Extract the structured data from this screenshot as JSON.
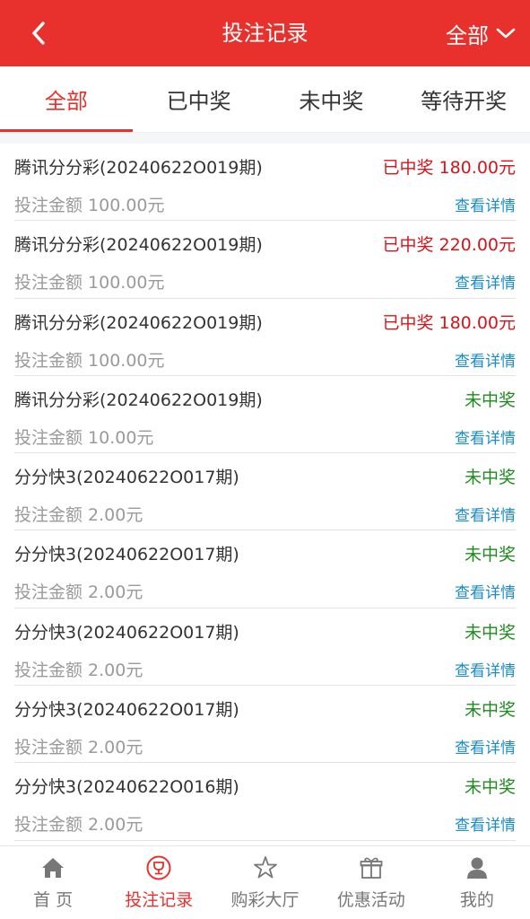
{
  "header": {
    "title": "投注记录",
    "filter_label": "全部",
    "back_icon": "chevron-left-icon",
    "filter_icon": "chevron-down-icon"
  },
  "tabs": [
    {
      "label": "全部",
      "active": true
    },
    {
      "label": "已中奖",
      "active": false
    },
    {
      "label": "未中奖",
      "active": false
    },
    {
      "label": "等待开奖",
      "active": false
    }
  ],
  "bets": [
    {
      "name": "腾讯分分彩(20240622O019期)",
      "result": "已中奖 180.00元",
      "status": "win",
      "amount": "投注金额 100.00元",
      "detail": "查看详情"
    },
    {
      "name": "腾讯分分彩(20240622O019期)",
      "result": "已中奖 220.00元",
      "status": "win",
      "amount": "投注金额 100.00元",
      "detail": "查看详情"
    },
    {
      "name": "腾讯分分彩(20240622O019期)",
      "result": "已中奖 180.00元",
      "status": "win",
      "amount": "投注金额 100.00元",
      "detail": "查看详情"
    },
    {
      "name": "腾讯分分彩(20240622O019期)",
      "result": "未中奖",
      "status": "lose",
      "amount": "投注金额 10.00元",
      "detail": "查看详情"
    },
    {
      "name": "分分快3(20240622O017期)",
      "result": "未中奖",
      "status": "lose",
      "amount": "投注金额 2.00元",
      "detail": "查看详情"
    },
    {
      "name": "分分快3(20240622O017期)",
      "result": "未中奖",
      "status": "lose",
      "amount": "投注金额 2.00元",
      "detail": "查看详情"
    },
    {
      "name": "分分快3(20240622O017期)",
      "result": "未中奖",
      "status": "lose",
      "amount": "投注金额 2.00元",
      "detail": "查看详情"
    },
    {
      "name": "分分快3(20240622O017期)",
      "result": "未中奖",
      "status": "lose",
      "amount": "投注金额 2.00元",
      "detail": "查看详情"
    },
    {
      "name": "分分快3(20240622O016期)",
      "result": "未中奖",
      "status": "lose",
      "amount": "投注金额 2.00元",
      "detail": "查看详情"
    }
  ],
  "nav": [
    {
      "label": "首 页",
      "icon": "home-icon",
      "active": false
    },
    {
      "label": "投注记录",
      "icon": "trophy-icon",
      "active": true
    },
    {
      "label": "购彩大厅",
      "icon": "star-icon",
      "active": false
    },
    {
      "label": "优惠活动",
      "icon": "gift-icon",
      "active": false
    },
    {
      "label": "我的",
      "icon": "user-icon",
      "active": false
    }
  ],
  "colors": {
    "brand_red": "#e8302c",
    "win_red": "#d7141a",
    "lose_green": "#1f8b1f",
    "link_blue": "#1a8cc7"
  }
}
